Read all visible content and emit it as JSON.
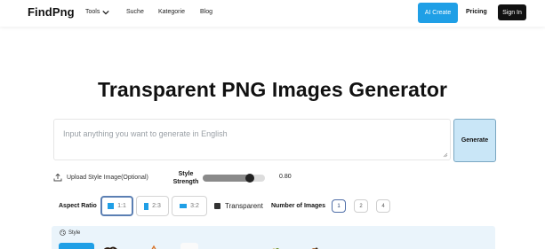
{
  "nav": {
    "logo": "FindPng",
    "tools": "Tools",
    "suche": "Suche",
    "kategorie": "Kategorie",
    "blog": "Blog",
    "ai_create": "AI Create",
    "pricing": "Pricing",
    "sign_in": "Sign In"
  },
  "hero": {
    "title": "Transparent PNG Images Generator",
    "prompt_placeholder": "Input anything you want to generate in English",
    "generate": "Generate"
  },
  "controls": {
    "upload_label": "Upload Style Image(Optional)",
    "strength_label": "Style Strength",
    "strength_value": "0.80",
    "strength_fraction": 0.8,
    "aspect_label": "Aspect Ratio",
    "aspect_ratios": [
      "1:1",
      "2:3",
      "3:2"
    ],
    "aspect_selected": "1:1",
    "transparent_label": "Transparent",
    "transparent_checked": true,
    "num_images_label": "Number of Images",
    "num_images_options": [
      "1",
      "2",
      "4"
    ],
    "num_images_selected": "1"
  },
  "style_panel": {
    "title": "Style"
  },
  "colors": {
    "accent": "#1f9fe6",
    "generate_bg": "#c9e6f7",
    "style_panel_bg": "#eaf4fb"
  },
  "icons": {
    "tools_chevron": "chevron-down-icon",
    "upload": "upload-icon",
    "style": "palette-icon"
  }
}
